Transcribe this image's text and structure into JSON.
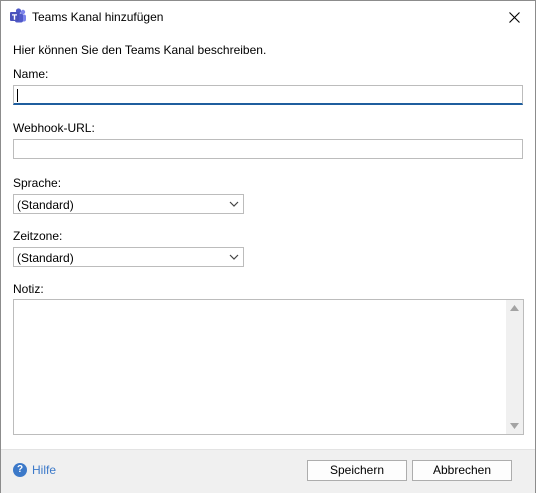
{
  "window": {
    "title": "Teams Kanal hinzufügen",
    "icon": "teams-icon"
  },
  "form": {
    "description": "Hier können Sie den Teams Kanal beschreiben.",
    "name_label": "Name:",
    "name_value": "",
    "webhook_label": "Webhook-URL:",
    "webhook_value": "",
    "language_label": "Sprache:",
    "language_value": "(Standard)",
    "timezone_label": "Zeitzone:",
    "timezone_value": "(Standard)",
    "note_label": "Notiz:",
    "note_value": ""
  },
  "footer": {
    "help_label": "Hilfe",
    "save_label": "Speichern",
    "cancel_label": "Abbrechen"
  },
  "colors": {
    "accent": "#1f5e9e",
    "help": "#3c79c9",
    "footer_bg": "#f0f0f0"
  }
}
